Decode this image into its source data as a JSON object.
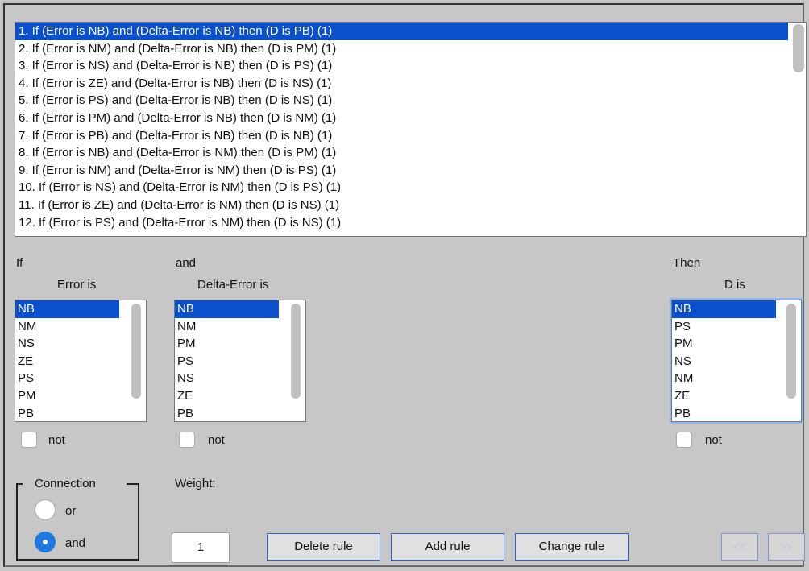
{
  "rules": [
    "1. If (Error is NB) and (Delta-Error is NB) then (D is PB) (1)",
    "2. If (Error is NM) and (Delta-Error is NB) then (D is PM) (1)",
    "3. If (Error is NS) and (Delta-Error is NB) then (D is PS) (1)",
    "4. If (Error is ZE) and (Delta-Error is NB) then (D is NS) (1)",
    "5. If (Error is PS) and (Delta-Error is NB) then (D is NS) (1)",
    "6. If (Error is PM) and (Delta-Error is NB) then (D is NM) (1)",
    "7. If (Error is PB) and (Delta-Error is NB) then (D is NB) (1)",
    "8. If (Error is NB) and (Delta-Error is NM) then (D is PM) (1)",
    "9. If (Error is NM) and (Delta-Error is NM) then (D is PS) (1)",
    "10. If (Error is NS) and (Delta-Error is NM) then (D is PS) (1)",
    "11. If (Error is ZE) and (Delta-Error is NM) then (D is NS) (1)",
    "12. If (Error is PS) and (Delta-Error is NM) then (D is NS) (1)"
  ],
  "labels": {
    "if": "If",
    "and": "and",
    "then": "Then",
    "error_is": "Error is",
    "delta_error_is": "Delta-Error is",
    "d_is": "D is",
    "not": "not",
    "connection": "Connection",
    "or": "or",
    "and_option": "and",
    "weight": "Weight:"
  },
  "error_list": [
    "NB",
    "NM",
    "NS",
    "ZE",
    "PS",
    "PM",
    "PB"
  ],
  "delta_error_list": [
    "NB",
    "NM",
    "PM",
    "PS",
    "NS",
    "ZE",
    "PB"
  ],
  "d_list": [
    "NB",
    "PS",
    "PM",
    "NS",
    "NM",
    "ZE",
    "PB"
  ],
  "weight_value": "1",
  "connection_selected": "and",
  "buttons": {
    "delete": "Delete rule",
    "add": "Add rule",
    "change": "Change rule",
    "prev": "<<",
    "next": ">>"
  },
  "colors": {
    "selection": "#0a4fcb",
    "radio_on": "#1f7ae0",
    "background": "#c7c7c7"
  }
}
